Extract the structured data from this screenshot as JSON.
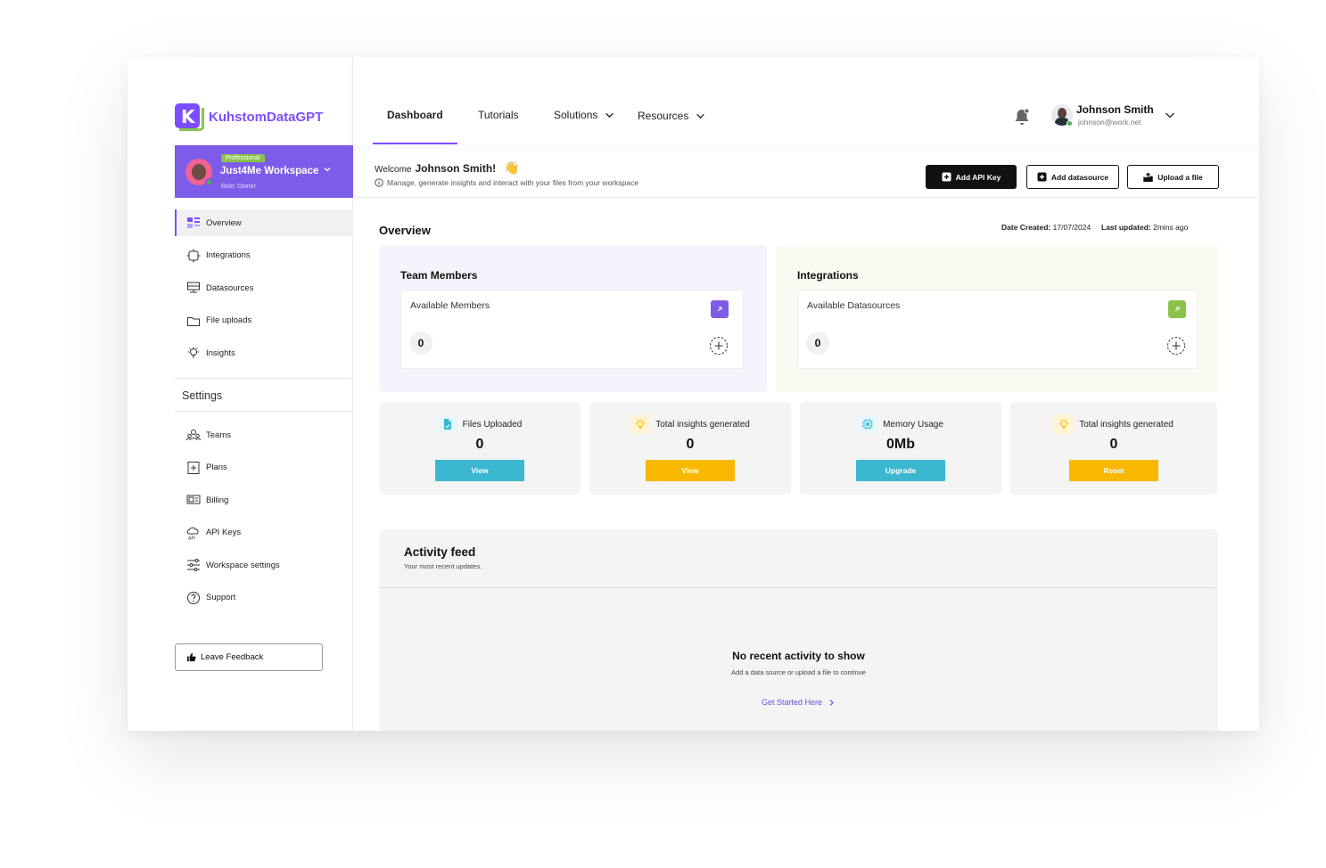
{
  "brand": {
    "name": "KuhstomDataGPT",
    "logo_letter": "K"
  },
  "workspace": {
    "plan": "Professional",
    "name": "Just4Me Workspace",
    "role": "Role: Owner"
  },
  "sidebar": {
    "main_items": [
      {
        "label": "Overview",
        "icon": "overview-icon",
        "active": true
      },
      {
        "label": "Integrations",
        "icon": "integrations-icon"
      },
      {
        "label": "Datasources",
        "icon": "datasources-icon"
      },
      {
        "label": "File uploads",
        "icon": "folder-icon"
      },
      {
        "label": "Insights",
        "icon": "lightbulb-icon"
      }
    ],
    "settings_label": "Settings",
    "settings_items": [
      {
        "label": "Teams",
        "icon": "teams-icon"
      },
      {
        "label": "Plans",
        "icon": "plans-icon"
      },
      {
        "label": "Billing",
        "icon": "billing-icon"
      },
      {
        "label": "API Keys",
        "icon": "api-keys-icon"
      },
      {
        "label": "Workspace settings",
        "icon": "sliders-icon"
      },
      {
        "label": "Support",
        "icon": "help-icon"
      }
    ],
    "feedback_label": "Leave Feedback"
  },
  "topnav": {
    "tabs": [
      {
        "label": "Dashboard",
        "active": true
      },
      {
        "label": "Tutorials"
      },
      {
        "label": "Solutions",
        "dropdown": true
      },
      {
        "label": "Resources",
        "dropdown": true
      }
    ]
  },
  "user": {
    "name": "Johnson Smith",
    "email": "johnson@work.net"
  },
  "welcome": {
    "prefix": "Welcome",
    "name": "Johnson Smith!",
    "emoji": "👋",
    "subtitle": "Manage, generate insights and interact with your files from your workspace"
  },
  "actions": {
    "add_api_key": "Add API Key",
    "add_datasource": "Add datasource",
    "upload_file": "Upload a file"
  },
  "overview": {
    "title": "Overview",
    "date_created_label": "Date Created:",
    "date_created": "17/07/2024",
    "last_updated_label": "Last updated:",
    "last_updated": "2mins ago"
  },
  "team_card": {
    "title": "Team Members",
    "label": "Available Members",
    "count": "0"
  },
  "integrations_card": {
    "title": "Integrations",
    "label": "Available Datasources",
    "count": "0"
  },
  "stats": [
    {
      "label": "Files Uploaded",
      "value": "0",
      "button": "View",
      "icon": "file-icon",
      "btn_color": "#3bb8cf"
    },
    {
      "label": "Total insights generated",
      "value": "0",
      "button": "View",
      "icon": "lightbulb-icon",
      "btn_color": "#f8b800"
    },
    {
      "label": "Memory Usage",
      "value": "0Mb",
      "button": "Upgrade",
      "icon": "chip-icon",
      "btn_color": "#3bb8cf"
    },
    {
      "label": "Total insights generated",
      "value": "0",
      "button": "Reset",
      "icon": "lightbulb-icon",
      "btn_color": "#f8b800"
    }
  ],
  "feed": {
    "title": "Activity feed",
    "subtitle": "Your most recent updates.",
    "empty_title": "No recent activity to show",
    "empty_subtitle": "Add a data source or upload a file to continue",
    "cta": "Get Started Here"
  },
  "colors": {
    "accent": "#7c4dff",
    "green": "#8bc34a",
    "teal": "#3bb8cf",
    "yellow": "#f8b800"
  }
}
